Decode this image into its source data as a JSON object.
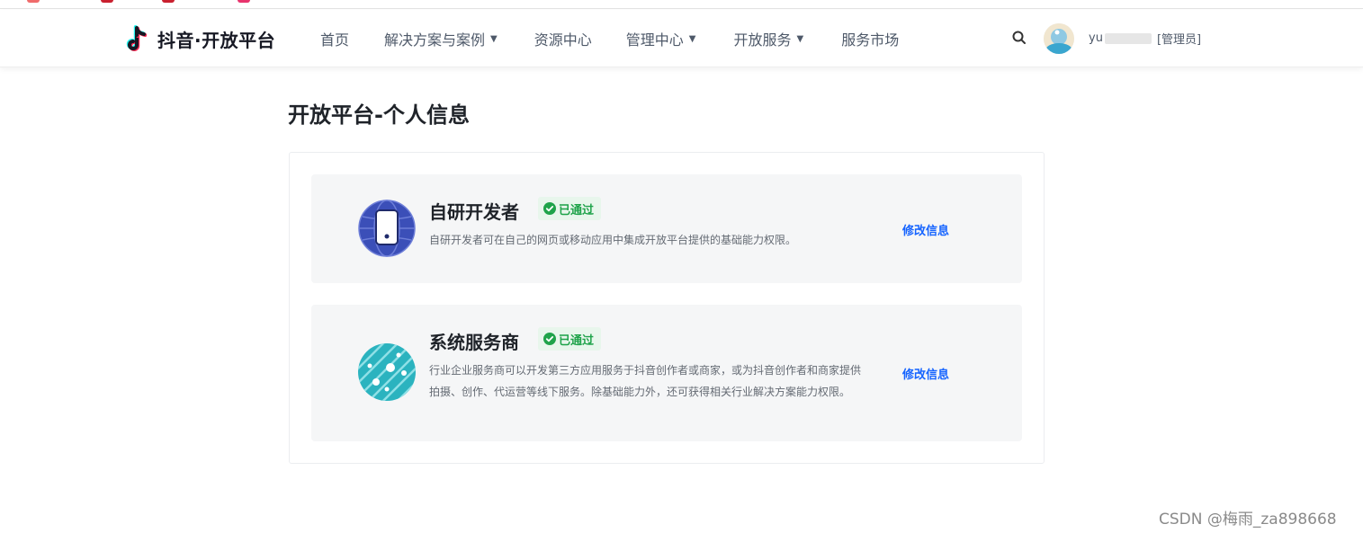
{
  "header": {
    "logo_text": "抖音·开放平台",
    "nav": [
      {
        "label": "首页",
        "has_dropdown": false
      },
      {
        "label": "解决方案与案例",
        "has_dropdown": true
      },
      {
        "label": "资源中心",
        "has_dropdown": false
      },
      {
        "label": "管理中心",
        "has_dropdown": true
      },
      {
        "label": "开放服务",
        "has_dropdown": true
      },
      {
        "label": "服务市场",
        "has_dropdown": false
      }
    ],
    "search_icon": "search-icon",
    "user": {
      "name_prefix": "yu",
      "role": "[管理员]"
    }
  },
  "page": {
    "title": "开放平台-个人信息"
  },
  "cards": [
    {
      "title": "自研开发者",
      "status": "已通过",
      "description": "自研开发者可在自己的网页或移动应用中集成开放平台提供的基础能力权限。",
      "action": "修改信息",
      "icon": "globe-phone-icon"
    },
    {
      "title": "系统服务商",
      "status": "已通过",
      "description": "行业企业服务商可以开发第三方应用服务于抖音创作者或商家，或为抖音创作者和商家提供拍摄、创作、代运营等线下服务。除基础能力外，还可获得相关行业解决方案能力权限。",
      "action": "修改信息",
      "icon": "network-globe-icon"
    }
  ],
  "watermark": "CSDN @梅雨_za898668",
  "colors": {
    "accent": "#1664ff",
    "success": "#1fa34a",
    "card_bg": "#f5f6f7"
  }
}
